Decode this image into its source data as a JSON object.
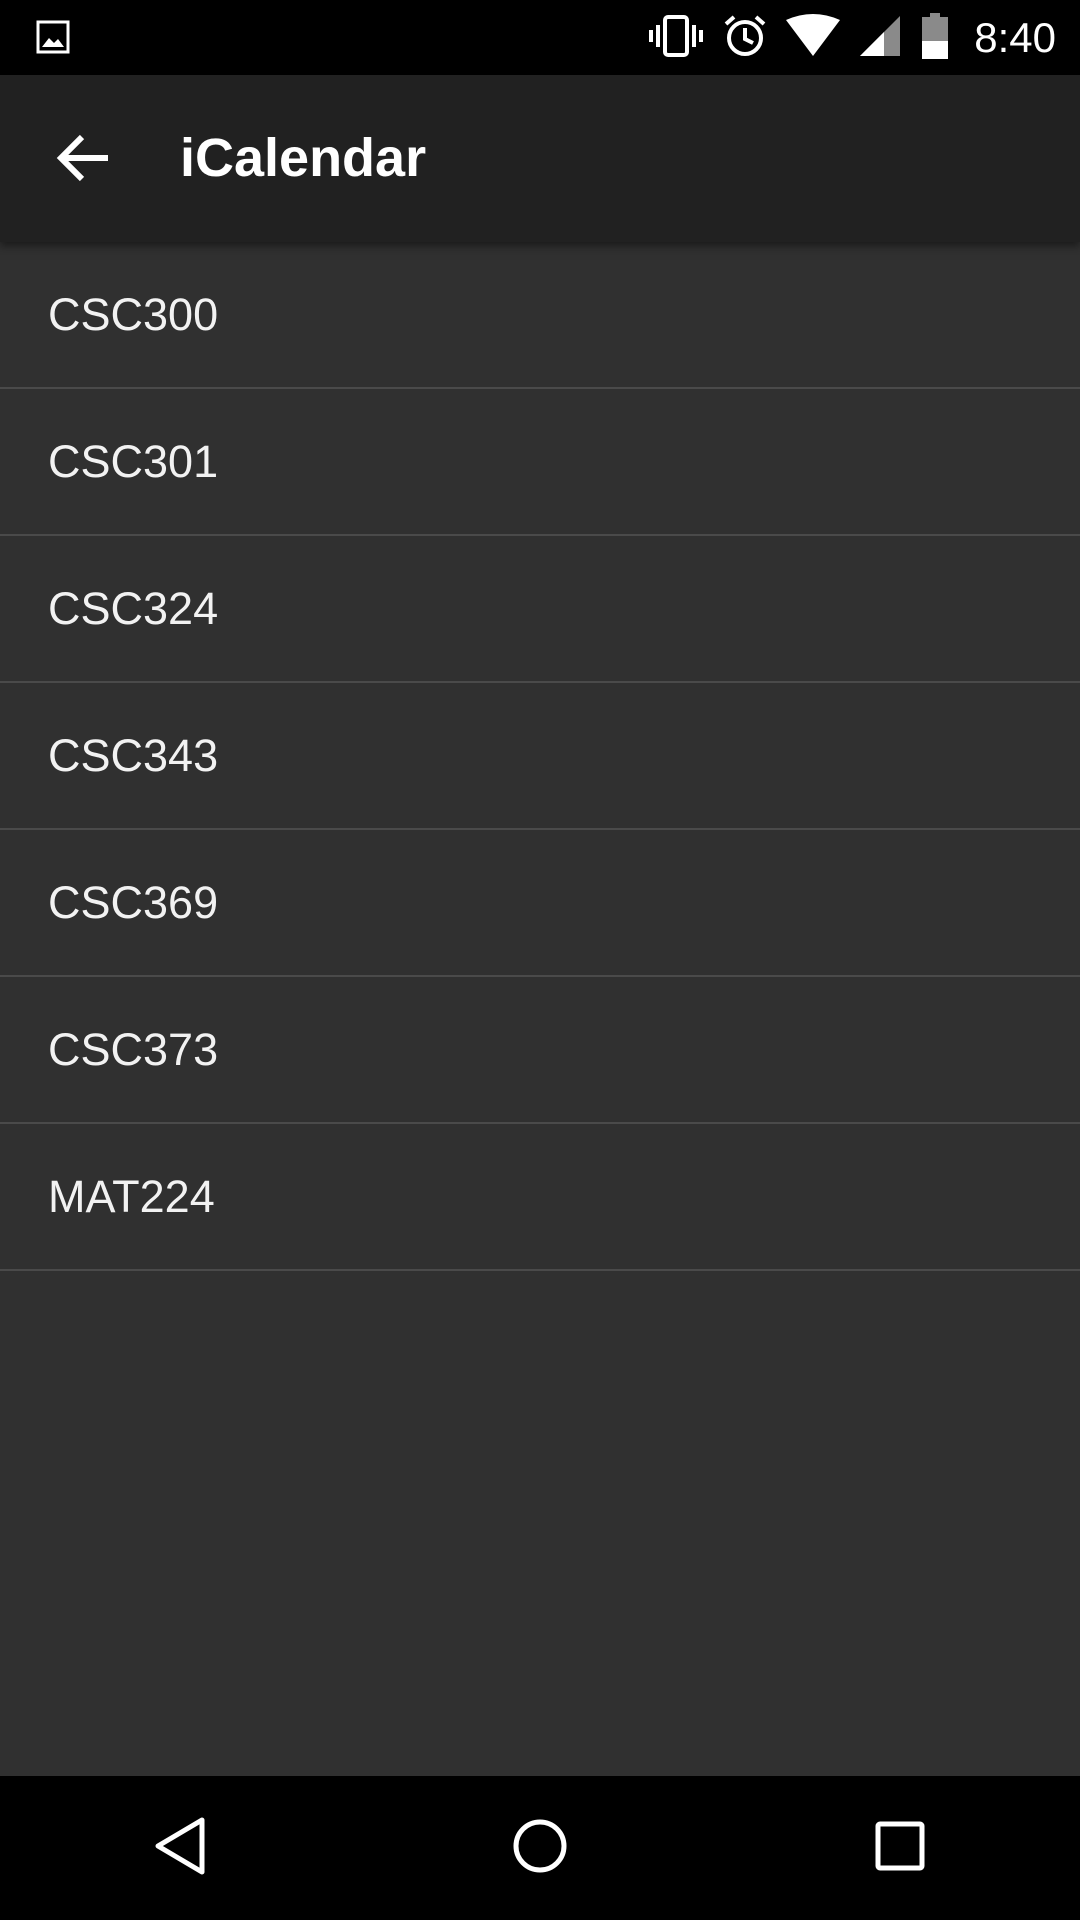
{
  "status_bar": {
    "time": "8:40",
    "icons": [
      "image-notification-icon",
      "vibrate-icon",
      "alarm-icon",
      "wifi-icon",
      "cell-signal-icon",
      "battery-icon"
    ]
  },
  "app_bar": {
    "title": "iCalendar",
    "back_icon": "arrow-back-icon"
  },
  "list": {
    "items": [
      {
        "label": "CSC300"
      },
      {
        "label": "CSC301"
      },
      {
        "label": "CSC324"
      },
      {
        "label": "CSC343"
      },
      {
        "label": "CSC369"
      },
      {
        "label": "CSC373"
      },
      {
        "label": "MAT224"
      }
    ]
  },
  "nav_bar": {
    "icons": [
      "back-triangle-icon",
      "home-circle-icon",
      "recents-square-icon"
    ]
  },
  "colors": {
    "status_bar": "#000000",
    "app_bar": "#212121",
    "background": "#303030",
    "divider": "#4a4a4a",
    "text": "#f2f2f2"
  }
}
